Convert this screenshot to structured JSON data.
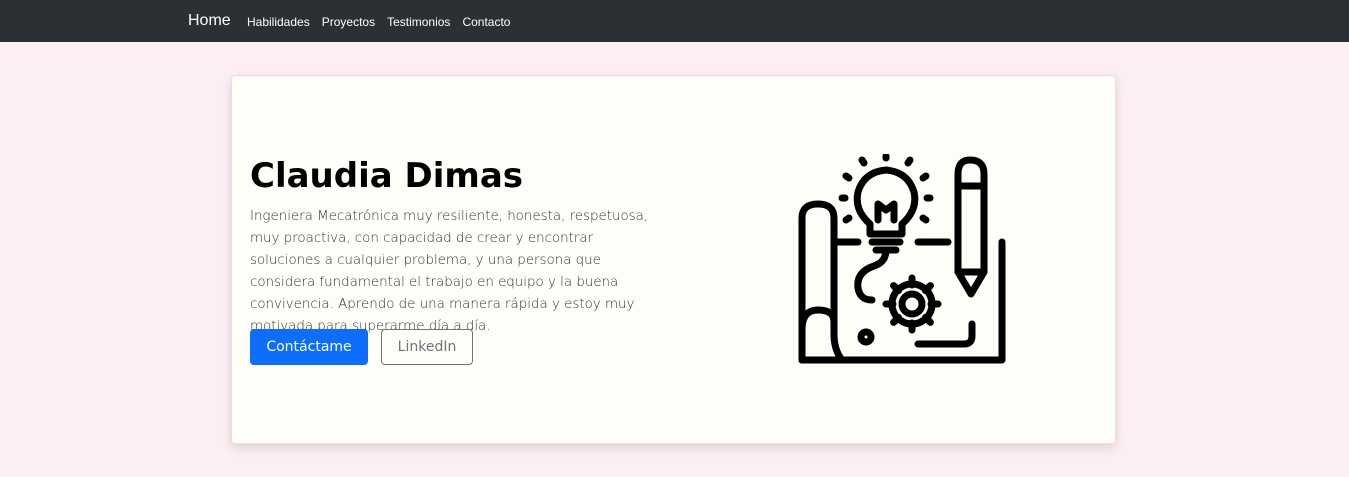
{
  "navbar": {
    "brand": "Home",
    "links": [
      "Habilidades",
      "Proyectos",
      "Testimonios",
      "Contacto"
    ]
  },
  "hero": {
    "name": "Claudia Dimas",
    "description": "Ingeniera Mecatrónica muy resiliente, honesta, respetuosa, muy proactiva, con capacidad de crear y encontrar soluciones a cualquier problema, y una persona que considera fundamental el trabajo en equipo y la buena convivencia. Aprendo de una manera rápida y estoy muy motivada para superarme día a día.",
    "primary_button": "Contáctame",
    "secondary_button": "LinkedIn",
    "illustration_icon": "engineering-blueprint-icon"
  },
  "colors": {
    "navbar_bg": "#2b3035",
    "page_bg": "#fdeef3",
    "card_bg": "#fffdf8",
    "primary": "#0d6efd",
    "secondary": "#6c757d"
  }
}
